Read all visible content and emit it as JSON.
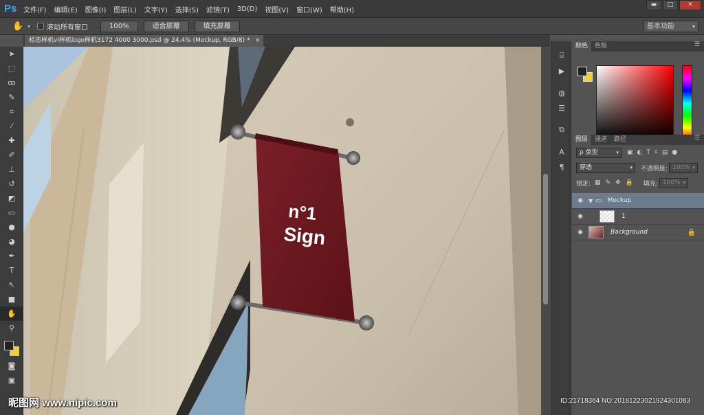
{
  "app": {
    "logo": "Ps"
  },
  "menu": [
    "文件(F)",
    "编辑(E)",
    "图像(I)",
    "图层(L)",
    "文字(Y)",
    "选择(S)",
    "滤镜(T)",
    "3D(D)",
    "视图(V)",
    "窗口(W)",
    "帮助(H)"
  ],
  "window_controls": {
    "minimize": "▬",
    "maximize": "□",
    "close": "✕"
  },
  "options": {
    "scroll_all_label": "滚动所有窗口",
    "zoom_button": "100%",
    "fit_screen_button": "适合屏幕",
    "fill_screen_button": "填充屏幕",
    "workspace": "基本功能"
  },
  "document_tab": {
    "title": "标志样机vi样机logo样机3172 4000 3000.psd @ 24.4% (Mockup, RGB/8) *",
    "close": "×"
  },
  "sign": {
    "line1": "n°1",
    "line2": "Sign"
  },
  "color_panel": {
    "tabs": [
      "颜色",
      "色板"
    ]
  },
  "layers_panel": {
    "tabs": [
      "图层",
      "通道",
      "路径"
    ],
    "filter_kind": "ρ 类型",
    "blend_mode": "穿透",
    "opacity_label": "不透明度:",
    "opacity_value": "100%",
    "lock_label": "锁定:",
    "fill_label": "填充:",
    "fill_value": "100%",
    "layers": [
      {
        "name": "Mockup",
        "type": "group",
        "selected": true
      },
      {
        "name": "1",
        "type": "smart-object",
        "selected": false
      },
      {
        "name": "Background",
        "type": "background",
        "selected": false
      }
    ]
  },
  "watermark": {
    "site": "昵图网 www.nipic.com",
    "id": "ID:21718364 NO:20181223021924301083"
  },
  "colors": {
    "sign": "#6e1a22",
    "accent": "#31a8ff",
    "background_swatch": "#f2cf3a"
  }
}
